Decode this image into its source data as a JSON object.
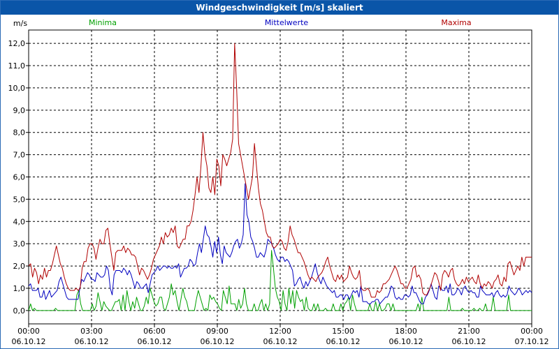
{
  "window": {
    "title": "Windgeschwindigkeit [m/s] skaliert"
  },
  "chart_data": {
    "type": "line",
    "title": "Windgeschwindigkeit [m/s] skaliert",
    "ylabel": "m/s",
    "xlabel": "",
    "ylim": [
      -0.6,
      12.6
    ],
    "yticks": [
      "0,0",
      "1,0",
      "2,0",
      "3,0",
      "4,0",
      "5,0",
      "6,0",
      "7,0",
      "8,0",
      "9,0",
      "10,0",
      "11,0",
      "12,0"
    ],
    "xlim": [
      0,
      24
    ],
    "xticks": [
      {
        "time": "00:00",
        "date": "06.10.12"
      },
      {
        "time": "03:00",
        "date": "06.10.12"
      },
      {
        "time": "06:00",
        "date": "06.10.12"
      },
      {
        "time": "09:00",
        "date": "06.10.12"
      },
      {
        "time": "12:00",
        "date": "06.10.12"
      },
      {
        "time": "15:00",
        "date": "06.10.12"
      },
      {
        "time": "18:00",
        "date": "06.10.12"
      },
      {
        "time": "21:00",
        "date": "06.10.12"
      },
      {
        "time": "00:00",
        "date": "07.10.12"
      }
    ],
    "grid": true,
    "legend_placement": "top",
    "series": [
      {
        "name": "Minima",
        "color": "#00a000",
        "values": [
          0.0,
          0.3,
          0.0,
          0.1,
          0.0,
          0.0,
          0.0,
          0.0,
          0.0,
          0.0,
          0.0,
          0.0,
          0.0,
          0.0,
          0.1,
          0.0,
          0.0,
          0.0,
          0.0,
          0.0,
          0.0,
          0.0,
          0.0,
          0.0,
          0.0,
          0.7,
          0.9,
          0.3,
          0.0,
          0.0,
          0.0,
          0.0,
          0.0,
          0.3,
          0.0,
          0.2,
          0.8,
          0.4,
          0.0,
          0.4,
          0.2,
          0.1,
          0.0,
          0.0,
          0.2,
          0.4,
          0.4,
          0.5,
          0.0,
          0.7,
          0.0,
          0.9,
          0.4,
          0.0,
          0.4,
          0.1,
          0.6,
          0.3,
          0.0,
          0.0,
          0.2,
          0.6,
          0.3,
          1.0,
          0.7,
          0.4,
          0.2,
          0.3,
          0.6,
          0.6,
          0.1,
          0.0,
          0.3,
          0.6,
          1.2,
          0.7,
          0.9,
          0.4,
          0.0,
          0.5,
          1.0,
          0.6,
          0.4,
          0.0,
          0.0,
          0.0,
          0.0,
          0.5,
          0.9,
          0.6,
          0.3,
          0.0,
          0.1,
          0.0,
          0.7,
          0.5,
          0.6,
          0.4,
          0.3,
          0.1,
          0.0,
          0.9,
          0.6,
          0.3,
          1.1,
          0.3,
          0.3,
          0.3,
          0.0,
          0.5,
          0.1,
          0.3,
          1.0,
          0.3,
          0.0,
          0.0,
          0.0,
          0.3,
          0.0,
          0.0,
          0.3,
          0.5,
          0.0,
          0.3,
          0.0,
          0.3,
          2.7,
          1.9,
          1.0,
          0.6,
          0.4,
          0.0,
          0.9,
          0.3,
          0.0,
          1.0,
          0.3,
          0.9,
          0.1,
          0.9,
          0.6,
          0.4,
          0.5,
          0.0,
          0.6,
          0.1,
          0.0,
          0.0,
          0.3,
          0.0,
          0.3,
          0.0,
          0.0,
          0.0,
          0.1,
          0.0,
          0.0,
          0.0,
          0.3,
          0.0,
          0.0,
          0.0,
          0.3,
          0.0,
          0.3,
          0.4,
          0.6,
          0.0,
          0.7,
          0.3,
          0.0,
          0.0,
          0.0,
          0.0,
          0.0,
          0.0,
          0.0,
          0.3,
          0.0,
          0.0,
          0.4,
          0.0,
          0.3,
          0.0,
          0.0,
          0.1,
          0.3,
          0.3,
          0.0,
          0.3,
          0.0,
          0.0,
          0.0,
          0.0,
          0.0,
          0.0,
          0.0,
          0.0,
          0.0,
          0.0,
          0.0,
          0.0,
          0.3,
          0.0,
          0.6,
          0.0,
          0.0,
          0.0,
          0.0,
          0.0,
          0.0,
          0.0,
          0.0,
          0.0,
          0.0,
          0.0,
          0.0,
          0.0,
          0.6,
          0.0,
          0.0,
          0.0,
          0.0,
          0.0,
          0.0,
          0.1,
          0.0,
          0.0,
          0.0,
          0.0,
          0.0,
          0.1,
          0.0,
          0.0,
          0.1,
          0.0,
          0.0,
          0.3,
          0.0,
          0.0,
          0.0,
          0.6,
          0.0,
          0.0,
          0.0,
          0.0,
          0.0,
          0.0,
          0.0,
          0.7,
          0.0,
          0.0,
          0.0,
          0.0,
          0.0,
          0.0,
          0.0,
          0.0,
          0.0,
          0.0,
          0.0,
          0.0
        ]
      },
      {
        "name": "Mittelwerte",
        "color": "#0000c0",
        "values": [
          1.1,
          1.2,
          0.9,
          0.9,
          0.9,
          1.0,
          0.6,
          0.6,
          0.9,
          0.5,
          0.7,
          0.9,
          0.6,
          0.7,
          0.8,
          0.9,
          1.3,
          1.5,
          1.2,
          0.9,
          0.6,
          0.5,
          0.5,
          0.5,
          0.5,
          0.5,
          0.5,
          1.0,
          1.4,
          1.3,
          1.5,
          1.7,
          1.6,
          1.4,
          1.4,
          1.3,
          1.7,
          1.6,
          1.5,
          1.5,
          1.6,
          2.0,
          1.8,
          1.0,
          0.7,
          1.6,
          1.8,
          1.8,
          1.8,
          1.7,
          1.9,
          1.8,
          1.6,
          1.8,
          1.6,
          1.3,
          1.0,
          1.3,
          1.2,
          1.0,
          1.0,
          1.1,
          1.2,
          0.8,
          1.2,
          1.6,
          1.7,
          1.8,
          2.0,
          1.8,
          1.9,
          2.0,
          2.0,
          1.9,
          2.0,
          1.9,
          1.9,
          2.0,
          1.9,
          2.1,
          1.5,
          1.7,
          1.9,
          1.9,
          2.0,
          2.3,
          2.2,
          2.0,
          2.1,
          2.6,
          3.0,
          2.6,
          3.2,
          3.8,
          3.4,
          3.3,
          2.9,
          2.4,
          3.1,
          2.6,
          3.3,
          2.5,
          2.1,
          2.9,
          2.6,
          2.5,
          2.4,
          2.6,
          2.9,
          3.1,
          3.2,
          2.8,
          3.0,
          3.4,
          5.7,
          4.3,
          4.0,
          3.3,
          3.1,
          2.8,
          2.4,
          2.4,
          2.6,
          2.5,
          2.4,
          2.7,
          3.2,
          3.1,
          3.0,
          2.8,
          2.5,
          2.3,
          2.2,
          2.4,
          2.4,
          2.2,
          2.3,
          2.2,
          2.0,
          1.8,
          1.1,
          1.2,
          1.4,
          1.5,
          1.2,
          1.0,
          1.3,
          1.1,
          1.3,
          1.5,
          1.8,
          2.1,
          1.7,
          1.4,
          1.2,
          1.5,
          1.3,
          1.1,
          1.0,
          0.9,
          0.8,
          0.9,
          0.6,
          0.6,
          0.7,
          0.7,
          0.5,
          0.7,
          0.7,
          0.5,
          0.7,
          0.9,
          0.8,
          0.9,
          0.6,
          1.1,
          0.4,
          0.4,
          0.4,
          0.3,
          0.3,
          0.4,
          0.4,
          0.5,
          0.5,
          0.3,
          0.4,
          0.5,
          0.6,
          0.6,
          0.8,
          1.1,
          1.0,
          0.6,
          0.5,
          0.6,
          0.5,
          0.5,
          0.7,
          0.7,
          0.6,
          0.7,
          1.1,
          0.8,
          0.8,
          0.6,
          0.4,
          0.3,
          0.3,
          0.6,
          0.7,
          0.9,
          1.2,
          0.9,
          0.6,
          0.5,
          1.1,
          1.0,
          0.9,
          0.9,
          1.1,
          0.8,
          1.2,
          0.7,
          0.7,
          0.8,
          1.0,
          0.9,
          0.7,
          1.0,
          1.1,
          0.9,
          0.8,
          0.9,
          0.8,
          0.8,
          0.6,
          0.6,
          1.1,
          0.9,
          0.8,
          0.7,
          0.7,
          0.7,
          0.8,
          0.6,
          0.8,
          0.9,
          0.7,
          0.6,
          0.7,
          0.6,
          0.7,
          1.1,
          0.9,
          0.8,
          0.7,
          0.8,
          1.0,
          0.9,
          0.7,
          0.8,
          0.9,
          0.8,
          0.9,
          0.8
        ]
      },
      {
        "name": "Maxima",
        "color": "#b00000",
        "values": [
          2.0,
          2.1,
          1.5,
          1.9,
          1.7,
          1.2,
          1.6,
          1.4,
          1.9,
          1.5,
          1.8,
          1.8,
          2.1,
          2.5,
          2.9,
          2.5,
          2.1,
          1.9,
          1.5,
          1.2,
          1.0,
          0.9,
          0.9,
          0.9,
          1.0,
          0.9,
          1.0,
          1.9,
          2.2,
          2.2,
          2.8,
          3.0,
          3.0,
          2.8,
          2.3,
          2.8,
          3.2,
          3.0,
          3.0,
          3.6,
          3.7,
          3.0,
          2.4,
          1.8,
          2.6,
          2.7,
          2.7,
          2.7,
          2.9,
          2.6,
          2.8,
          2.7,
          2.5,
          2.5,
          2.4,
          2.0,
          1.6,
          1.9,
          1.8,
          1.6,
          1.4,
          1.6,
          1.9,
          2.3,
          2.5,
          2.7,
          2.9,
          3.3,
          3.0,
          3.5,
          3.3,
          3.4,
          3.7,
          3.5,
          3.8,
          2.9,
          2.8,
          3.0,
          3.2,
          3.2,
          3.8,
          3.8,
          4.0,
          4.5,
          5.2,
          6.0,
          5.3,
          6.5,
          8.0,
          7.0,
          6.5,
          5.5,
          5.3,
          6.0,
          5.2,
          6.8,
          6.5,
          5.6,
          7.0,
          6.8,
          6.5,
          6.8,
          7.1,
          7.7,
          12.0,
          10.0,
          7.5,
          7.0,
          6.5,
          6.0,
          5.5,
          5.0,
          5.5,
          6.0,
          7.5,
          6.5,
          5.5,
          4.8,
          4.5,
          4.0,
          3.5,
          3.3,
          3.3,
          2.9,
          2.8,
          2.9,
          3.0,
          3.2,
          3.1,
          2.8,
          2.7,
          3.1,
          3.8,
          3.4,
          3.2,
          2.9,
          2.6,
          2.6,
          2.4,
          2.2,
          1.9,
          1.6,
          1.4,
          1.5,
          1.4,
          1.3,
          1.5,
          1.6,
          1.7,
          1.9,
          2.2,
          2.4,
          2.0,
          1.7,
          1.4,
          1.3,
          1.6,
          1.4,
          1.6,
          1.3,
          1.4,
          1.5,
          2.0,
          1.7,
          1.5,
          1.4,
          1.5,
          1.8,
          1.0,
          0.9,
          0.9,
          1.0,
          0.9,
          0.6,
          0.6,
          0.6,
          0.9,
          0.8,
          0.9,
          1.2,
          1.2,
          1.3,
          1.4,
          1.6,
          1.8,
          2.0,
          1.8,
          1.5,
          1.2,
          1.2,
          1.0,
          1.0,
          1.2,
          1.4,
          1.9,
          2.0,
          1.5,
          1.6,
          1.4,
          0.8,
          0.7,
          0.7,
          0.9,
          1.1,
          1.4,
          1.7,
          1.6,
          1.3,
          0.9,
          1.6,
          1.8,
          1.7,
          1.5,
          1.8,
          1.9,
          1.4,
          1.2,
          1.1,
          1.2,
          1.4,
          1.2,
          1.5,
          1.3,
          1.4,
          1.5,
          1.3,
          1.2,
          1.6,
          1.2,
          1.0,
          1.2,
          1.1,
          1.3,
          1.2,
          1.0,
          1.3,
          1.4,
          1.6,
          1.2,
          1.1,
          1.5,
          1.3,
          2.1,
          2.2,
          1.9,
          1.6,
          1.8,
          2.0,
          1.8,
          2.4,
          2.0,
          2.4,
          2.4,
          2.4,
          2.4
        ]
      }
    ]
  }
}
